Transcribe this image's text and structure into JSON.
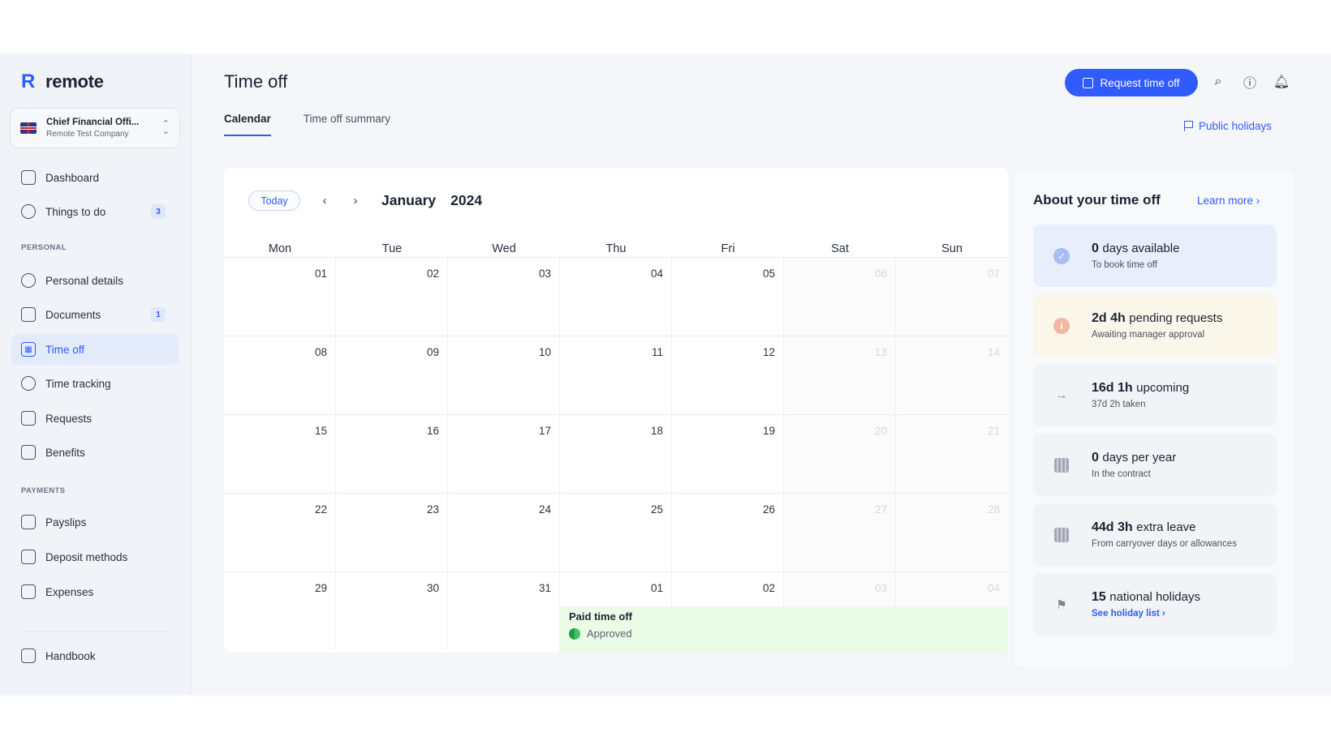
{
  "brand": {
    "name": "remote"
  },
  "account": {
    "title": "Chief Financial Offi...",
    "company": "Remote Test Company"
  },
  "nav": {
    "dashboard": "Dashboard",
    "things_to_do": "Things to do",
    "things_to_do_count": "3",
    "personal_label": "PERSONAL",
    "personal_details": "Personal details",
    "documents": "Documents",
    "documents_count": "1",
    "time_off": "Time off",
    "time_tracking": "Time tracking",
    "requests": "Requests",
    "benefits": "Benefits",
    "payments_label": "PAYMENTS",
    "payslips": "Payslips",
    "deposit_methods": "Deposit methods",
    "expenses": "Expenses",
    "handbook": "Handbook"
  },
  "header": {
    "title": "Time off",
    "request_button": "Request time off",
    "public_holidays": "Public holidays"
  },
  "tabs": [
    {
      "label": "Calendar",
      "active": true
    },
    {
      "label": "Time off summary",
      "active": false
    }
  ],
  "calendar": {
    "today": "Today",
    "month": "January",
    "year": "2024",
    "weekdays": [
      "Mon",
      "Tue",
      "Wed",
      "Thu",
      "Fri",
      "Sat",
      "Sun"
    ],
    "weeks": [
      [
        "01",
        "02",
        "03",
        "04",
        "05",
        "06",
        "07"
      ],
      [
        "08",
        "09",
        "10",
        "11",
        "12",
        "13",
        "14"
      ],
      [
        "15",
        "16",
        "17",
        "18",
        "19",
        "20",
        "21"
      ],
      [
        "22",
        "23",
        "24",
        "25",
        "26",
        "27",
        "28"
      ],
      [
        "29",
        "30",
        "31",
        "01",
        "02",
        "03",
        "04"
      ]
    ],
    "event": {
      "title": "Paid time off",
      "status": "Approved"
    }
  },
  "about": {
    "title": "About your time off",
    "learn_more": "Learn more ›",
    "cards": [
      {
        "big": "0",
        "rest": "days available",
        "sub": "To book time off",
        "icon": "check-icon"
      },
      {
        "big": "2d 4h",
        "rest": "pending requests",
        "sub": "Awaiting manager approval",
        "icon": "info-icon"
      },
      {
        "big": "16d 1h",
        "rest": "upcoming",
        "sub": "37d 2h taken",
        "icon": "arrow-right-icon"
      },
      {
        "big": "0",
        "rest": "days per year",
        "sub": "In the contract",
        "icon": "calendar-icon"
      },
      {
        "big": "44d 3h",
        "rest": "extra leave",
        "sub": "From carryover days or allowances",
        "icon": "calendar-icon"
      },
      {
        "big": "15",
        "rest": "national holidays",
        "sub": "See holiday list ›",
        "icon": "flag-icon"
      }
    ]
  },
  "colors": {
    "accent": "#2f5bff",
    "event_bg": "#eafbe6",
    "approved": "#1f9d46"
  }
}
